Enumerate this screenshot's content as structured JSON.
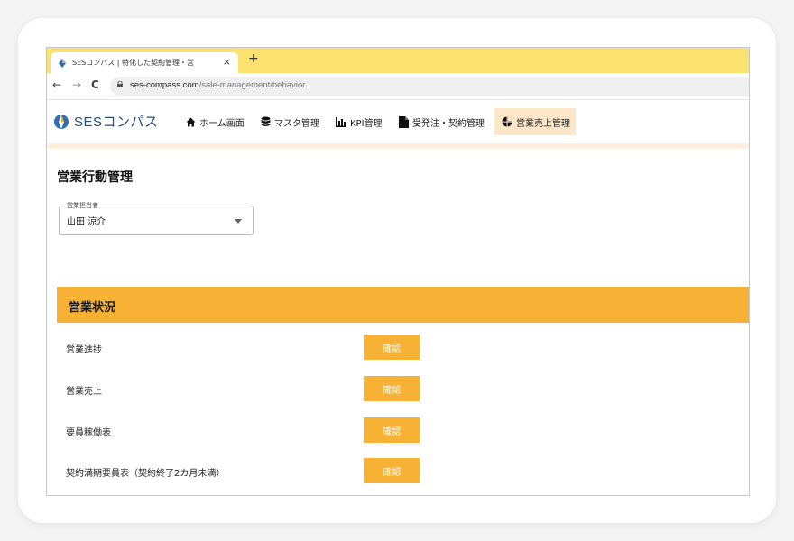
{
  "browser": {
    "tab_title": "SESコンパス | 特化した契約管理・営",
    "tab_close": "×",
    "new_tab": "+",
    "url_host": "ses-compass.com",
    "url_path": "/sale-management/behavior",
    "back": "←",
    "forward": "→",
    "reload": "C"
  },
  "header": {
    "logo_text": "SESコンパス",
    "nav": [
      {
        "label": "ホーム画面",
        "icon": "home-icon"
      },
      {
        "label": "マスタ管理",
        "icon": "database-icon"
      },
      {
        "label": "KPI管理",
        "icon": "bar-chart-icon"
      },
      {
        "label": "受発注・契約管理",
        "icon": "document-icon"
      },
      {
        "label": "営業売上管理",
        "icon": "pie-chart-icon"
      }
    ],
    "active_nav": "営業売上管理",
    "accent_color": "#f7b135"
  },
  "main": {
    "page_title": "営業行動管理",
    "assignee": {
      "label": "営業担当者",
      "value": "山田 涼介"
    },
    "section_title": "営業状況",
    "rows": [
      {
        "label": "営業進捗",
        "button": "確認"
      },
      {
        "label": "営業売上",
        "button": "確認"
      },
      {
        "label": "要員稼働表",
        "button": "確認"
      },
      {
        "label": "契約満期要員表（契約終了2カ月未満）",
        "button": "確認"
      }
    ]
  }
}
